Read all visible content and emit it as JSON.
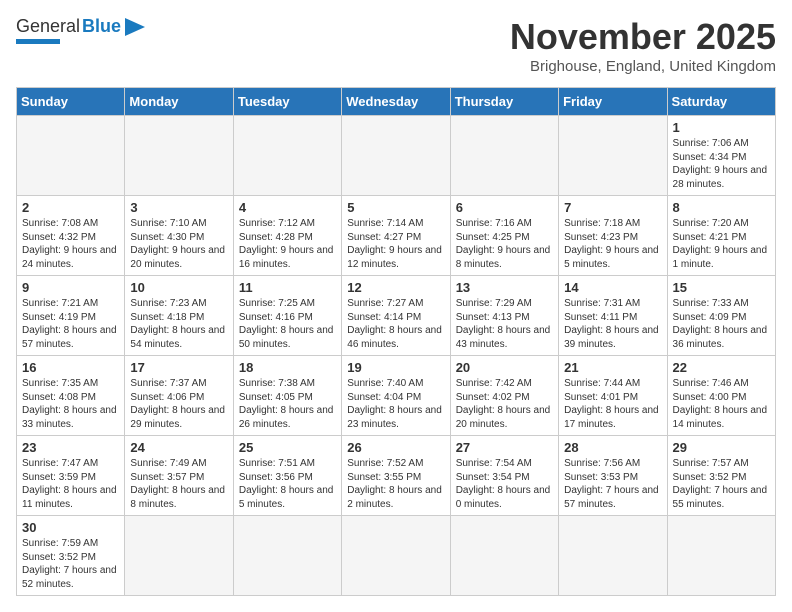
{
  "header": {
    "logo_general": "General",
    "logo_blue": "Blue",
    "month_title": "November 2025",
    "subtitle": "Brighouse, England, United Kingdom"
  },
  "days_of_week": [
    "Sunday",
    "Monday",
    "Tuesday",
    "Wednesday",
    "Thursday",
    "Friday",
    "Saturday"
  ],
  "weeks": [
    [
      {
        "day": "",
        "info": ""
      },
      {
        "day": "",
        "info": ""
      },
      {
        "day": "",
        "info": ""
      },
      {
        "day": "",
        "info": ""
      },
      {
        "day": "",
        "info": ""
      },
      {
        "day": "",
        "info": ""
      },
      {
        "day": "1",
        "info": "Sunrise: 7:06 AM\nSunset: 4:34 PM\nDaylight: 9 hours\nand 28 minutes."
      }
    ],
    [
      {
        "day": "2",
        "info": "Sunrise: 7:08 AM\nSunset: 4:32 PM\nDaylight: 9 hours\nand 24 minutes."
      },
      {
        "day": "3",
        "info": "Sunrise: 7:10 AM\nSunset: 4:30 PM\nDaylight: 9 hours\nand 20 minutes."
      },
      {
        "day": "4",
        "info": "Sunrise: 7:12 AM\nSunset: 4:28 PM\nDaylight: 9 hours\nand 16 minutes."
      },
      {
        "day": "5",
        "info": "Sunrise: 7:14 AM\nSunset: 4:27 PM\nDaylight: 9 hours\nand 12 minutes."
      },
      {
        "day": "6",
        "info": "Sunrise: 7:16 AM\nSunset: 4:25 PM\nDaylight: 9 hours\nand 8 minutes."
      },
      {
        "day": "7",
        "info": "Sunrise: 7:18 AM\nSunset: 4:23 PM\nDaylight: 9 hours\nand 5 minutes."
      },
      {
        "day": "8",
        "info": "Sunrise: 7:20 AM\nSunset: 4:21 PM\nDaylight: 9 hours\nand 1 minute."
      }
    ],
    [
      {
        "day": "9",
        "info": "Sunrise: 7:21 AM\nSunset: 4:19 PM\nDaylight: 8 hours\nand 57 minutes."
      },
      {
        "day": "10",
        "info": "Sunrise: 7:23 AM\nSunset: 4:18 PM\nDaylight: 8 hours\nand 54 minutes."
      },
      {
        "day": "11",
        "info": "Sunrise: 7:25 AM\nSunset: 4:16 PM\nDaylight: 8 hours\nand 50 minutes."
      },
      {
        "day": "12",
        "info": "Sunrise: 7:27 AM\nSunset: 4:14 PM\nDaylight: 8 hours\nand 46 minutes."
      },
      {
        "day": "13",
        "info": "Sunrise: 7:29 AM\nSunset: 4:13 PM\nDaylight: 8 hours\nand 43 minutes."
      },
      {
        "day": "14",
        "info": "Sunrise: 7:31 AM\nSunset: 4:11 PM\nDaylight: 8 hours\nand 39 minutes."
      },
      {
        "day": "15",
        "info": "Sunrise: 7:33 AM\nSunset: 4:09 PM\nDaylight: 8 hours\nand 36 minutes."
      }
    ],
    [
      {
        "day": "16",
        "info": "Sunrise: 7:35 AM\nSunset: 4:08 PM\nDaylight: 8 hours\nand 33 minutes."
      },
      {
        "day": "17",
        "info": "Sunrise: 7:37 AM\nSunset: 4:06 PM\nDaylight: 8 hours\nand 29 minutes."
      },
      {
        "day": "18",
        "info": "Sunrise: 7:38 AM\nSunset: 4:05 PM\nDaylight: 8 hours\nand 26 minutes."
      },
      {
        "day": "19",
        "info": "Sunrise: 7:40 AM\nSunset: 4:04 PM\nDaylight: 8 hours\nand 23 minutes."
      },
      {
        "day": "20",
        "info": "Sunrise: 7:42 AM\nSunset: 4:02 PM\nDaylight: 8 hours\nand 20 minutes."
      },
      {
        "day": "21",
        "info": "Sunrise: 7:44 AM\nSunset: 4:01 PM\nDaylight: 8 hours\nand 17 minutes."
      },
      {
        "day": "22",
        "info": "Sunrise: 7:46 AM\nSunset: 4:00 PM\nDaylight: 8 hours\nand 14 minutes."
      }
    ],
    [
      {
        "day": "23",
        "info": "Sunrise: 7:47 AM\nSunset: 3:59 PM\nDaylight: 8 hours\nand 11 minutes."
      },
      {
        "day": "24",
        "info": "Sunrise: 7:49 AM\nSunset: 3:57 PM\nDaylight: 8 hours\nand 8 minutes."
      },
      {
        "day": "25",
        "info": "Sunrise: 7:51 AM\nSunset: 3:56 PM\nDaylight: 8 hours\nand 5 minutes."
      },
      {
        "day": "26",
        "info": "Sunrise: 7:52 AM\nSunset: 3:55 PM\nDaylight: 8 hours\nand 2 minutes."
      },
      {
        "day": "27",
        "info": "Sunrise: 7:54 AM\nSunset: 3:54 PM\nDaylight: 8 hours\nand 0 minutes."
      },
      {
        "day": "28",
        "info": "Sunrise: 7:56 AM\nSunset: 3:53 PM\nDaylight: 7 hours\nand 57 minutes."
      },
      {
        "day": "29",
        "info": "Sunrise: 7:57 AM\nSunset: 3:52 PM\nDaylight: 7 hours\nand 55 minutes."
      }
    ],
    [
      {
        "day": "30",
        "info": "Sunrise: 7:59 AM\nSunset: 3:52 PM\nDaylight: 7 hours\nand 52 minutes."
      },
      {
        "day": "",
        "info": ""
      },
      {
        "day": "",
        "info": ""
      },
      {
        "day": "",
        "info": ""
      },
      {
        "day": "",
        "info": ""
      },
      {
        "day": "",
        "info": ""
      },
      {
        "day": "",
        "info": ""
      }
    ]
  ]
}
